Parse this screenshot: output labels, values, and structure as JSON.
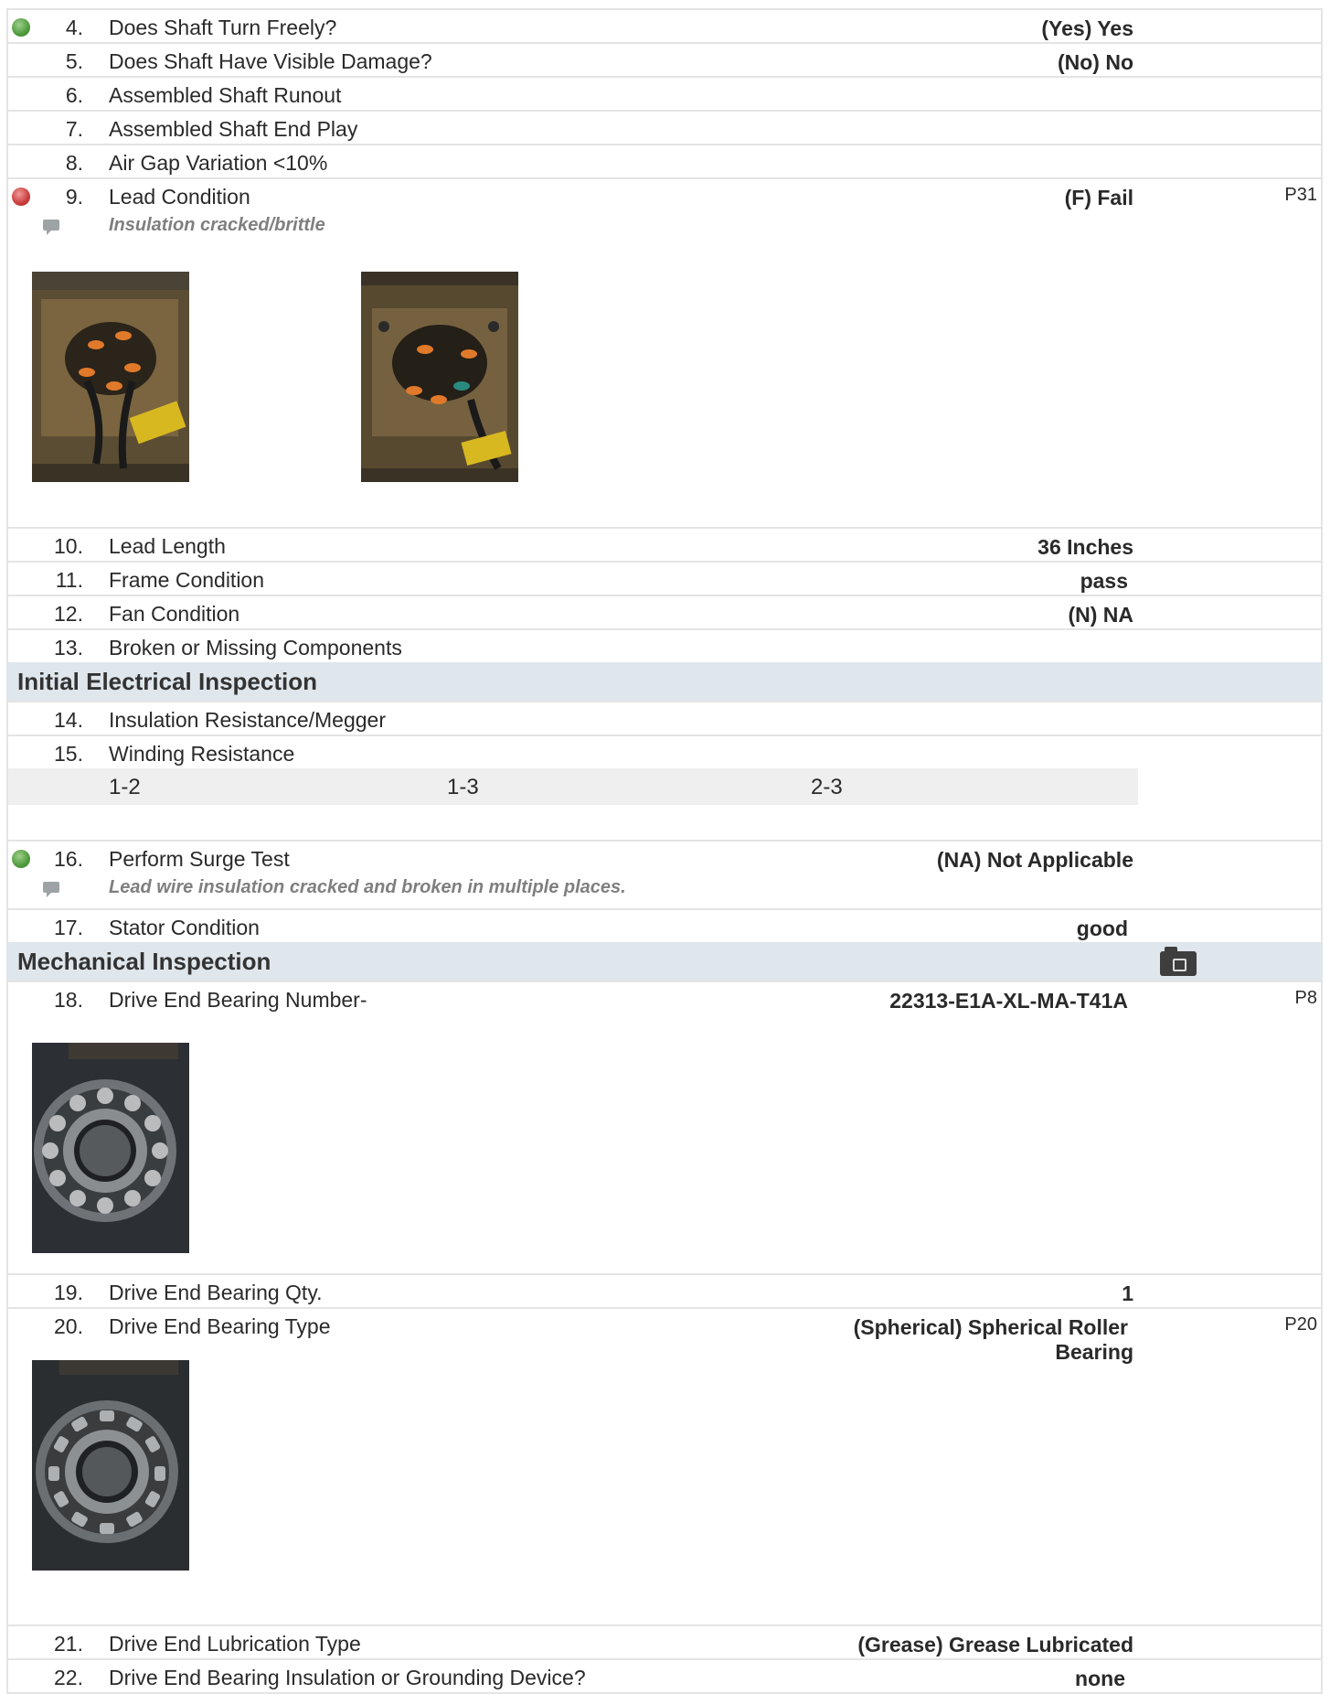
{
  "items": {
    "i4": {
      "num": "4.",
      "question": "Does Shaft Turn Freely?",
      "answer": "(Yes) Yes",
      "status": "green"
    },
    "i5": {
      "num": "5.",
      "question": "Does Shaft Have Visible Damage?",
      "answer": "(No) No"
    },
    "i6": {
      "num": "6.",
      "question": "Assembled Shaft Runout"
    },
    "i7": {
      "num": "7.",
      "question": "Assembled Shaft End Play"
    },
    "i8": {
      "num": "8.",
      "question": "Air Gap Variation <10%"
    },
    "i9": {
      "num": "9.",
      "question": "Lead Condition",
      "answer": "(F) Fail",
      "ref": "P31",
      "status": "red",
      "note": "Insulation cracked/brittle"
    },
    "i10": {
      "num": "10.",
      "question": "Lead Length",
      "answer": "36 Inches"
    },
    "i11": {
      "num": "11.",
      "question": "Frame Condition",
      "answer": "pass"
    },
    "i12": {
      "num": "12.",
      "question": "Fan Condition",
      "answer": "(N) NA"
    },
    "i13": {
      "num": "13.",
      "question": "Broken or Missing Components"
    },
    "i14": {
      "num": "14.",
      "question": "Insulation Resistance/Megger"
    },
    "i15": {
      "num": "15.",
      "question": "Winding Resistance",
      "columns": [
        "1-2",
        "1-3",
        "2-3"
      ]
    },
    "i16": {
      "num": "16.",
      "question": "Perform Surge Test",
      "answer": "(NA) Not Applicable",
      "status": "green",
      "note": "Lead wire insulation cracked and broken in multiple places."
    },
    "i17": {
      "num": "17.",
      "question": "Stator Condition",
      "answer": "good"
    },
    "i18": {
      "num": "18.",
      "question": "Drive End Bearing Number-",
      "answer": "22313-E1A-XL-MA-T41A",
      "ref": "P8"
    },
    "i19": {
      "num": "19.",
      "question": "Drive End Bearing Qty.",
      "answer": "1"
    },
    "i20": {
      "num": "20.",
      "question": "Drive End Bearing Type",
      "answer_line1": "(Spherical) Spherical Roller",
      "answer_line2": "Bearing",
      "ref": "P20"
    },
    "i21": {
      "num": "21.",
      "question": "Drive End Lubrication Type",
      "answer": "(Grease) Grease Lubricated"
    },
    "i22": {
      "num": "22.",
      "question": "Drive End Bearing Insulation or Grounding Device?",
      "answer": "none"
    }
  },
  "sections": {
    "electrical": "Initial Electrical Inspection",
    "mechanical": "Mechanical Inspection"
  },
  "icons": {
    "status_green": "green-status-dot-icon",
    "status_red": "red-status-dot-icon",
    "comment": "comment-icon",
    "camera": "camera-icon"
  },
  "colors": {
    "section_bg": "#dfe6ec",
    "status_green": "#4f9a3e",
    "status_red": "#c93c3c",
    "note_text": "#7f7f7f"
  }
}
